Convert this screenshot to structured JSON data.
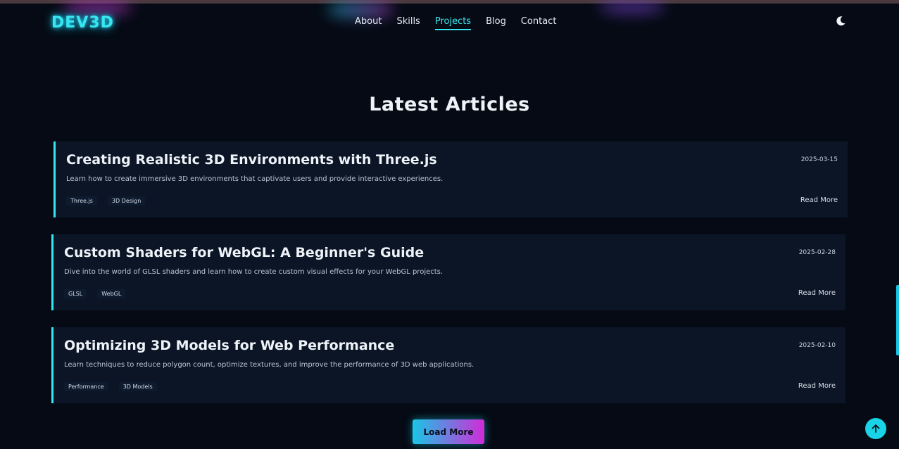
{
  "header": {
    "logo": "DEV3D",
    "nav": [
      "About",
      "Skills",
      "Projects",
      "Blog",
      "Contact"
    ],
    "active_nav": "Projects",
    "theme_toggle_icon": "moon-icon"
  },
  "blog": {
    "title": "Latest Articles",
    "articles": [
      {
        "title": "Creating Realistic 3D Environments with Three.js",
        "date": "2025-03-15",
        "description": "Learn how to create immersive 3D environments that captivate users and provide interactive experiences.",
        "tags": [
          "Three.js",
          "3D Design"
        ],
        "read_more": "Read More"
      },
      {
        "title": "Custom Shaders for WebGL: A Beginner's Guide",
        "date": "2025-02-28",
        "description": "Dive into the world of GLSL shaders and learn how to create custom visual effects for your WebGL projects.",
        "tags": [
          "GLSL",
          "WebGL"
        ],
        "read_more": "Read More"
      },
      {
        "title": "Optimizing 3D Models for Web Performance",
        "date": "2025-02-10",
        "description": "Learn techniques to reduce polygon count, optimize textures, and improve the performance of 3D web applications.",
        "tags": [
          "Performance",
          "3D Models"
        ],
        "read_more": "Read More"
      }
    ],
    "load_more": "Load More"
  },
  "scroll_top_icon": "arrow-up-icon",
  "colors": {
    "background": "#050a14",
    "card": "#0b1526",
    "accent": "#39e6f0",
    "accent_secondary": "#d12bd8"
  }
}
